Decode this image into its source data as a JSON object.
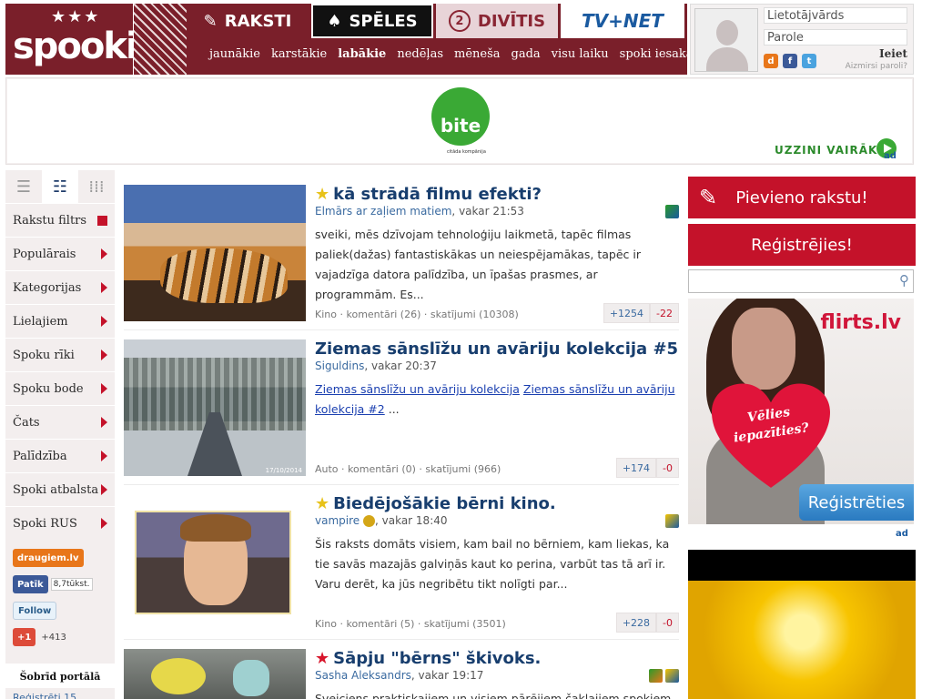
{
  "header": {
    "logo_text": "spooki",
    "tabs": [
      {
        "label": "RAKSTI",
        "icon": "pencil-square-icon"
      },
      {
        "label": "SPĒLES",
        "icon": "spade-icon"
      },
      {
        "label": "DIVĪTIS",
        "icon": "two-lati-coin-icon"
      },
      {
        "label": "TV+NET",
        "icon": "tvnet-logo"
      }
    ],
    "subnav": [
      "jaunākie",
      "karstākie",
      "labākie",
      "nedēļas",
      "mēneša",
      "gada",
      "visu laiku",
      "spoki iesaka"
    ],
    "active_subnav": "labākie"
  },
  "login": {
    "username_placeholder": "Lietotājvārds",
    "password_placeholder": "Parole",
    "submit_label": "Ieiet",
    "forgot_label": "Aizmirsi paroli?"
  },
  "banner": {
    "brand": "bite",
    "tagline": "citāda kompānija",
    "cta": "UZZINI VAIRĀK",
    "ad_label": "ad"
  },
  "sidebar": {
    "items": [
      {
        "label": "Rakstu filtrs",
        "marker": "square"
      },
      {
        "label": "Populārais",
        "marker": "arrow"
      },
      {
        "label": "Kategorijas",
        "marker": "arrow"
      },
      {
        "label": "Lielajiem",
        "marker": "arrow"
      },
      {
        "label": "Spoku rīki",
        "marker": "arrow"
      },
      {
        "label": "Spoku bode",
        "marker": "arrow"
      },
      {
        "label": "Čats",
        "marker": "arrow"
      },
      {
        "label": "Palīdzība",
        "marker": "arrow"
      },
      {
        "label": "Spoki atbalsta",
        "marker": "arrow"
      },
      {
        "label": "Spoki RUS",
        "marker": "arrow"
      }
    ],
    "social": {
      "draugiem": "draugiem.lv",
      "fb_like": "Patīk",
      "fb_count": "8,7tūkst.",
      "twitter": "Follow",
      "gplus": "+1",
      "gplus_count": "+413"
    },
    "portal_title": "Šobrīd portālā",
    "portal_line": "Reģistrēti 15"
  },
  "articles": [
    {
      "starred": "gold",
      "title": "kā strādā filmu efekti?",
      "author": "Elmārs ar zaļiem matiem",
      "time": "vakar 21:53",
      "excerpt": "sveiki, mēs dzīvojam tehnoloģiju laikmetā, tapēc filmas paliek(dažas) fantastiskākas un neiespējamākas, tapēc ir vajadzīga datora palīdzība, un īpašas prasmes, ar programmām. Es...",
      "category": "Kino",
      "comments": "komentāri (26)",
      "views": "skatījumi (10308)",
      "up": "+1254",
      "down": "-22"
    },
    {
      "starred": "",
      "title": "Ziemas sānslīžu un avāriju kolekcija #5",
      "author": "Siguldins",
      "time": "vakar 20:37",
      "links": [
        "Ziemas sānslīžu un avāriju kolekcija",
        "Ziemas sānslīžu un avāriju kolekcija #2"
      ],
      "ellipsis": "...",
      "category": "Auto",
      "comments": "komentāri (0)",
      "views": "skatījumi (966)",
      "up": "+174",
      "down": "-0",
      "thumb_caption": "17/10/2014"
    },
    {
      "starred": "gold",
      "title": "Biedējošākie bērni kino.",
      "author": "vampire",
      "time": "vakar 18:40",
      "excerpt": "Šis raksts domāts visiem, kam bail no bērniem, kam liekas, ka tie savās mazajās galviņās kaut ko perina, varbūt tas tā arī ir. Varu derēt, ka jūs negribētu tikt nolīgti par...",
      "category": "Kino",
      "comments": "komentāri (5)",
      "views": "skatījumi (3501)",
      "up": "+228",
      "down": "-0"
    },
    {
      "starred": "red",
      "title": "Sāpju \"bērns\" škivoks.",
      "author": "Sasha Aleksandrs",
      "time": "vakar 19:17",
      "excerpt": "Sveiciens praktiskajiem un visiem pārējiem čaklajiem spokiem !"
    }
  ],
  "right": {
    "add_article": "Pievieno rakstu!",
    "register": "Reģistrējies!",
    "search_placeholder": "",
    "flirts_logo": "flirts.lv",
    "flirts_heart": "Vēlies iepazīties?",
    "flirts_button": "Reģistrēties",
    "ad_label": "ad"
  },
  "colors": {
    "brand": "#7a1f2a",
    "accent": "#c4122a",
    "link": "#183e6e"
  }
}
